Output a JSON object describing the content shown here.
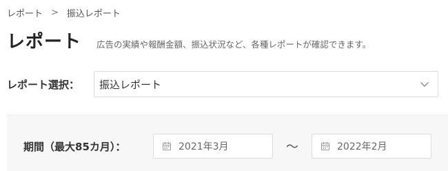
{
  "breadcrumb": {
    "items": [
      "レポート",
      "振込レポート"
    ],
    "separator": ">"
  },
  "header": {
    "title": "レポート",
    "description": "広告の実績や報酬金額、振込状況など、各種レポートが確認できます。"
  },
  "report_select": {
    "label": "レポート選択：",
    "value": "振込レポート",
    "icon": "chevron-down-icon"
  },
  "period": {
    "label": "期間（最大85カ月）：",
    "start": "2021年3月",
    "end": "2022年2月",
    "separator": "〜",
    "icon": "calendar-icon"
  },
  "colors": {
    "panel_background": "#f7f7f7",
    "border": "#dcdcdc",
    "text": "#333333"
  }
}
